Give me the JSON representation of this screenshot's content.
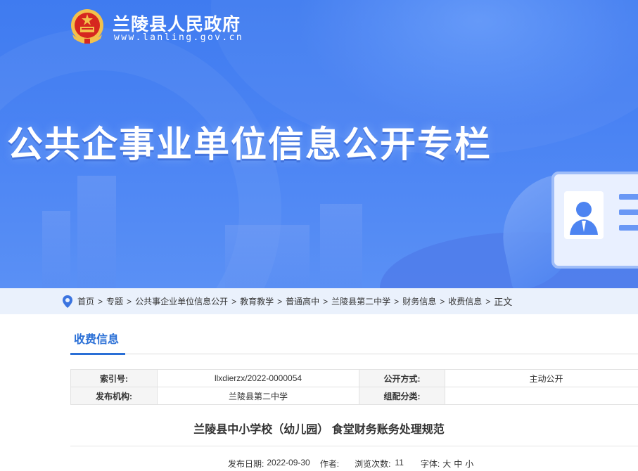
{
  "header": {
    "site_title": "兰陵县人民政府",
    "site_url": "www.lanling.gov.cn",
    "banner_headline": "公共企事业单位信息公开专栏",
    "emblem_icon": "national-emblem-icon"
  },
  "colors": {
    "banner_blue": "#4a83f3",
    "accent_blue": "#2a6fd6",
    "crumb_bg": "#eaf1fc"
  },
  "breadcrumb": {
    "items": [
      "首页",
      "专题",
      "公共事企业单位信息公开",
      "教育教学",
      "普通高中",
      "兰陵县第二中学",
      "财务信息",
      "收费信息"
    ],
    "separator": ">",
    "current": "正文",
    "icon": "location-pin-icon"
  },
  "section": {
    "title": "收费信息"
  },
  "meta": {
    "rows": [
      {
        "k1": "索引号:",
        "v1": "llxdierzx/2022-0000054",
        "k2": "公开方式:",
        "v2": "主动公开"
      },
      {
        "k1": "发布机构:",
        "v1": "兰陵县第二中学",
        "k2": "组配分类:",
        "v2": ""
      }
    ]
  },
  "article": {
    "title": "兰陵县中小学校（幼儿园） 食堂财务账务处理规范",
    "date_label": "发布日期:",
    "date": "2022-09-30",
    "author_label": "作者:",
    "author": "",
    "views_label": "浏览次数:",
    "views": "11",
    "font_label": "字体:",
    "font_sizes": [
      "大",
      "中",
      "小"
    ]
  }
}
